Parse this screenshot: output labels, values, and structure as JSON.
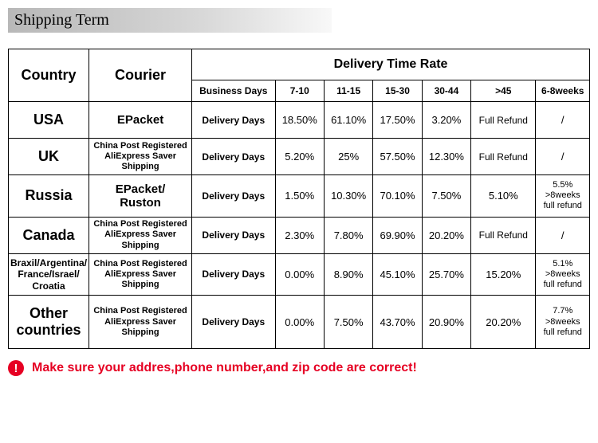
{
  "header": "Shipping Term",
  "table": {
    "col_country": "Country",
    "col_courier": "Courier",
    "col_delivery": "Delivery Time Rate",
    "sub": [
      "Business Days",
      "7-10",
      "11-15",
      "15-30",
      "30-44",
      ">45",
      "6-8weeks"
    ],
    "rows": [
      {
        "country": "USA",
        "country_class": "row-country",
        "courier": "EPacket",
        "courier_class": "row-courier",
        "label": "Delivery Days",
        "cells": [
          "18.50%",
          "61.10%",
          "17.50%",
          "3.20%",
          "Full Refund",
          "/"
        ]
      },
      {
        "country": "UK",
        "country_class": "row-country",
        "courier": "China Post Registered\nAliExpress Saver\nShipping",
        "courier_class": "row-courier-small",
        "label": "Delivery Days",
        "cells": [
          "5.20%",
          "25%",
          "57.50%",
          "12.30%",
          "Full Refund",
          "/"
        ]
      },
      {
        "country": "Russia",
        "country_class": "row-country",
        "courier": "EPacket/\nRuston",
        "courier_class": "row-courier",
        "label": "Delivery Days",
        "cells": [
          "1.50%",
          "10.30%",
          "70.10%",
          "7.50%",
          "5.10%",
          "5.5%\n>8weeks\nfull refund"
        ]
      },
      {
        "country": "Canada",
        "country_class": "row-country",
        "courier": "China Post Registered\nAliExpress Saver\nShipping",
        "courier_class": "row-courier-small",
        "label": "Delivery Days",
        "cells": [
          "2.30%",
          "7.80%",
          "69.90%",
          "20.20%",
          "Full Refund",
          "/"
        ]
      },
      {
        "country": "Braxil/Argentina/\nFrance/Israel/\nCroatia",
        "country_class": "row-country-small",
        "courier": "China Post Registered\nAliExpress Saver\nShipping",
        "courier_class": "row-courier-small",
        "label": "Delivery Days",
        "cells": [
          "0.00%",
          "8.90%",
          "45.10%",
          "25.70%",
          "15.20%",
          "5.1%\n>8weeks\nfull refund"
        ]
      },
      {
        "country": "Other\ncountries",
        "country_class": "row-country",
        "courier": "China Post Registered\nAliExpress Saver\nShipping",
        "courier_class": "row-courier-small",
        "label": "Delivery Days",
        "cells": [
          "0.00%",
          "7.50%",
          "43.70%",
          "20.90%",
          "20.20%",
          "7.7%\n>8weeks\nfull refund"
        ]
      }
    ]
  },
  "warning": "Make sure your addres,phone number,and zip code are correct!"
}
